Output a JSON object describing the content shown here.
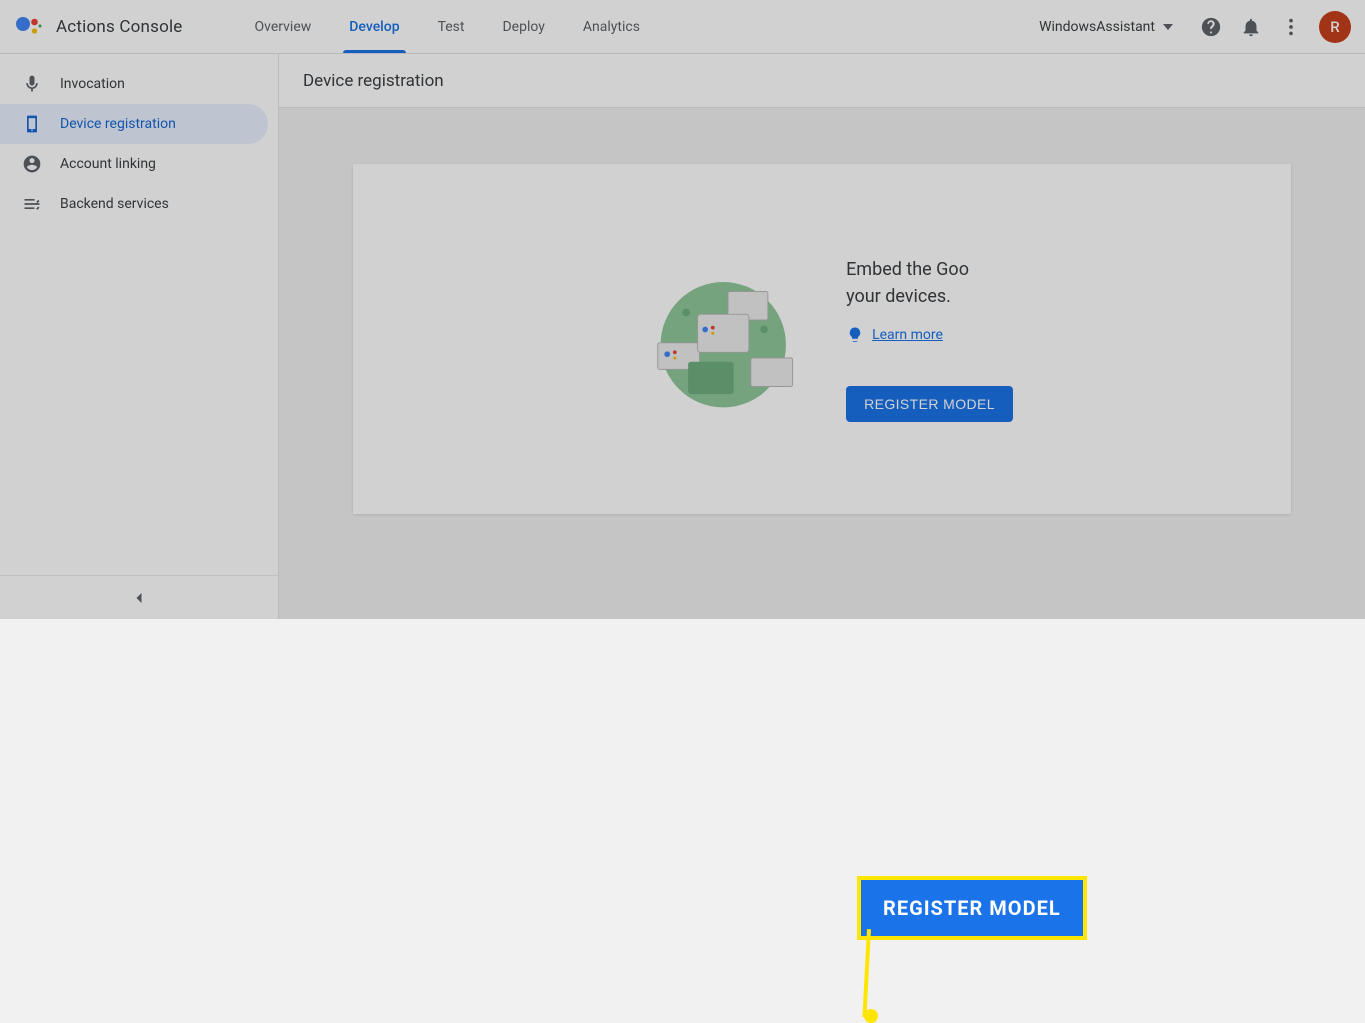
{
  "header": {
    "app_title": "Actions Console",
    "tabs": [
      {
        "label": "Overview",
        "active": false
      },
      {
        "label": "Develop",
        "active": true
      },
      {
        "label": "Test",
        "active": false
      },
      {
        "label": "Deploy",
        "active": false
      },
      {
        "label": "Analytics",
        "active": false
      }
    ],
    "project_name": "WindowsAssistant",
    "avatar_initial": "R"
  },
  "sidebar": {
    "items": [
      {
        "label": "Invocation",
        "icon": "mic-icon",
        "active": false
      },
      {
        "label": "Device registration",
        "icon": "device-icon",
        "active": true
      },
      {
        "label": "Account linking",
        "icon": "account-icon",
        "active": false
      },
      {
        "label": "Backend services",
        "icon": "settings-icon",
        "active": false
      }
    ]
  },
  "subheader": {
    "title": "Device registration"
  },
  "card": {
    "body_text": "Embed the Google Assistant in your devices.",
    "body_text_visible": "Embed the Goo\nyour devices.",
    "learn_more_label": "Learn more",
    "register_button_label": "REGISTER MODEL"
  },
  "annotation": {
    "callout_text": "REGISTER MODEL"
  },
  "colors": {
    "accent": "#1a73e8",
    "highlight": "#ffe600",
    "avatar_bg": "#c5401d"
  }
}
